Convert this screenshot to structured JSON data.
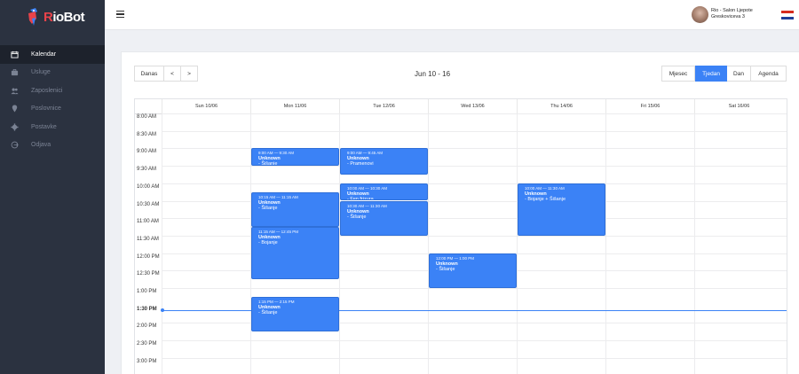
{
  "brand": {
    "logo_text_r": "R",
    "logo_text_rest": "ioBot",
    "accent": "#3b82f6",
    "sidebar_bg": "#2b3240"
  },
  "sidebar": {
    "items": [
      {
        "label": "Kalendar",
        "icon": "calendar-icon",
        "active": true
      },
      {
        "label": "Usluge",
        "icon": "briefcase-icon",
        "active": false
      },
      {
        "label": "Zaposlenici",
        "icon": "users-icon",
        "active": false
      },
      {
        "label": "Poslovnice",
        "icon": "map-marker-icon",
        "active": false
      },
      {
        "label": "Postavke",
        "icon": "gear-icon",
        "active": false
      },
      {
        "label": "Odjava",
        "icon": "logout-icon",
        "active": false
      }
    ]
  },
  "header": {
    "user_name": "Rio - Salon Ljepote",
    "user_address": "Greskoviceva 3",
    "flag": "croatia-flag-icon"
  },
  "toolbar": {
    "today": "Danas",
    "prev": "<",
    "next": ">",
    "range": "Jun 10 - 16",
    "views": [
      "Mjesec",
      "Tjedan",
      "Dan",
      "Agenda"
    ],
    "active_view": "Tjedan"
  },
  "calendar": {
    "days": [
      "Sun 10/06",
      "Mon 11/06",
      "Tue 12/06",
      "Wed 13/06",
      "Thu 14/06",
      "Fri 15/06",
      "Sat 16/06"
    ],
    "times": [
      "8:00 AM",
      "8:30 AM",
      "9:00 AM",
      "9:30 AM",
      "10:00 AM",
      "10:30 AM",
      "11:00 AM",
      "11:30 AM",
      "12:00 PM",
      "12:30 PM",
      "1:00 PM",
      "1:30 PM",
      "2:00 PM",
      "2:30 PM",
      "3:00 PM"
    ],
    "now_label": "1:30 PM",
    "events": [
      {
        "day": 1,
        "start": 9.0,
        "end": 9.5,
        "time": "9:00 AM — 9:30 AM",
        "name": "Unknown",
        "service": "- Šišanje"
      },
      {
        "day": 2,
        "start": 9.0,
        "end": 9.75,
        "time": "9:00 AM — 9:45 AM",
        "name": "Unknown",
        "service": "- Pramenovi"
      },
      {
        "day": 1,
        "start": 10.25,
        "end": 11.25,
        "time": "10:15 AM — 11:15 AM",
        "name": "Unknown",
        "service": "- Šišanje"
      },
      {
        "day": 2,
        "start": 10.0,
        "end": 10.5,
        "time": "10:00 AM — 10:30 AM",
        "name": "Unknown",
        "service": "- Fen frizura"
      },
      {
        "day": 2,
        "start": 10.5,
        "end": 11.5,
        "time": "10:30 AM — 11:30 AM",
        "name": "Unknown",
        "service": "- Šišanje"
      },
      {
        "day": 4,
        "start": 10.0,
        "end": 11.5,
        "time": "10:00 AM — 11:30 AM",
        "name": "Unknown",
        "service": "- Bojanje + Šišanje"
      },
      {
        "day": 1,
        "start": 11.25,
        "end": 12.75,
        "time": "11:15 AM — 12:45 PM",
        "name": "Unknown",
        "service": "- Bojanje"
      },
      {
        "day": 3,
        "start": 12.0,
        "end": 13.0,
        "time": "12:00 PM — 1:00 PM",
        "name": "Unknown",
        "service": "- Šišanje"
      },
      {
        "day": 1,
        "start": 13.25,
        "end": 14.25,
        "time": "1:15 PM — 2:15 PM",
        "name": "Unknown",
        "service": "- Šišanje"
      }
    ]
  }
}
